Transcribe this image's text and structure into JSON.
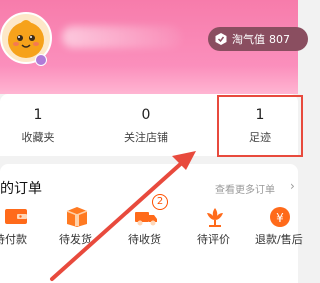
{
  "profile": {
    "taoqi_label": "淘气值",
    "taoqi_value": "807"
  },
  "stats": [
    {
      "count": "1",
      "label": "收藏夹"
    },
    {
      "count": "0",
      "label": "关注店铺"
    },
    {
      "count": "1",
      "label": "足迹"
    }
  ],
  "orders": {
    "title": "的订单",
    "more_label": "查看更多订单",
    "arrow": "›",
    "items": [
      {
        "label": "待付款",
        "icon": "wallet-icon",
        "badge": ""
      },
      {
        "label": "待发货",
        "icon": "package-icon",
        "badge": ""
      },
      {
        "label": "待收货",
        "icon": "truck-icon",
        "badge": "2"
      },
      {
        "label": "待评价",
        "icon": "flower-icon",
        "badge": ""
      },
      {
        "label": "退款/售后",
        "icon": "refund-icon",
        "badge": ""
      }
    ]
  },
  "colors": {
    "header_pink": "#f77cab",
    "accent_orange": "#ff5000",
    "annotation_red": "#e84a3d"
  }
}
